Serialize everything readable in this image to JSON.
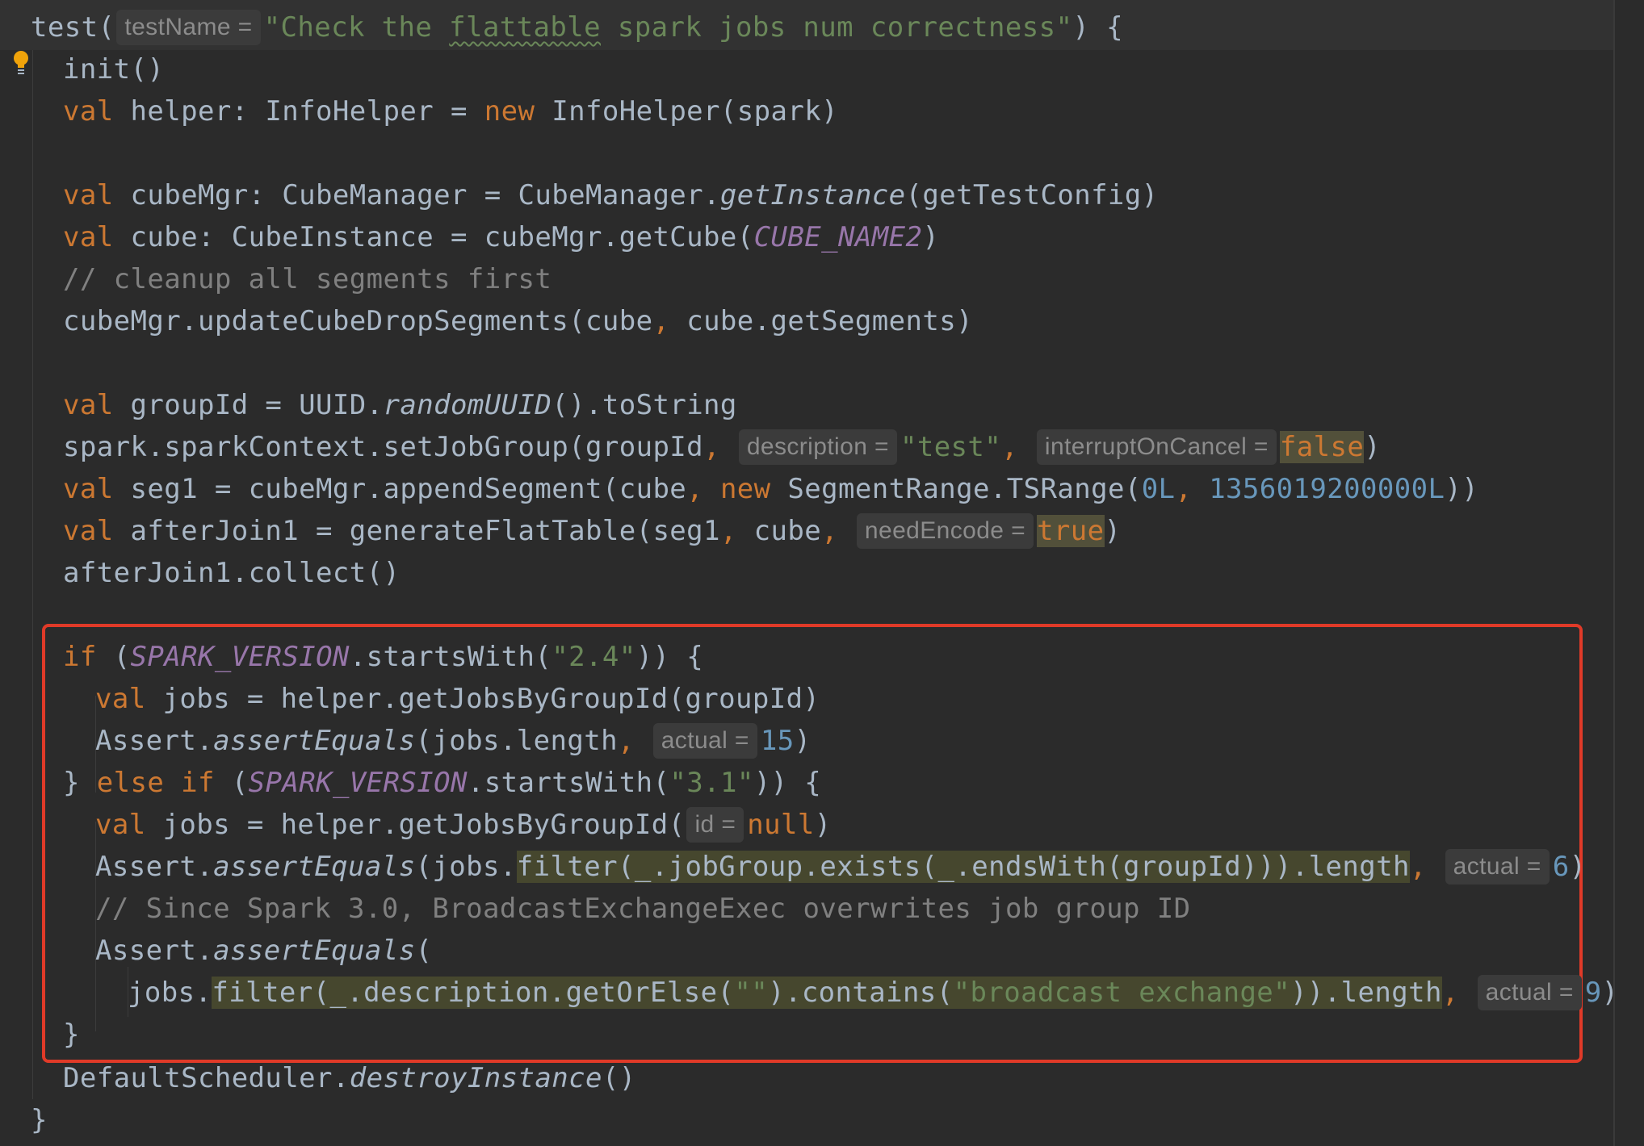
{
  "editor": {
    "theme_colors": {
      "background": "#2b2b2b",
      "keyword": "#cc7832",
      "string": "#6a8759",
      "number": "#6897bb",
      "comment": "#808080",
      "constant": "#9876aa",
      "text": "#a9b7c6",
      "highlight_box": "#e03a28"
    },
    "gutter_icons": [
      "lightbulb-icon"
    ],
    "highlighted_region": {
      "from_line": 16,
      "to_line": 25
    }
  },
  "code": {
    "l1": {
      "a": "test(",
      "hint": "testName =",
      "s1": "\"Check the ",
      "typo": "flattable",
      "s2": " spark jobs num correctness\"",
      "b": ") {"
    },
    "l2": {
      "a": "init()"
    },
    "l3": {
      "kw1": "val",
      "a": " helper: InfoHelper = ",
      "kw2": "new",
      "b": " InfoHelper(spark)"
    },
    "l4": {
      "kw1": "val",
      "a": " cubeMgr: CubeManager = CubeManager.",
      "it": "getInstance",
      "b": "(getTestConfig)"
    },
    "l5": {
      "kw1": "val",
      "a": " cube: CubeInstance = cubeMgr.getCube(",
      "c": "CUBE_NAME2",
      "b": ")"
    },
    "l6": {
      "cmt": "// cleanup all segments first"
    },
    "l7": {
      "a": "cubeMgr.updateCubeDropSegments(cube",
      "p": ",",
      "b": " cube.getSegments)"
    },
    "l8": {
      "kw1": "val",
      "a": " groupId = UUID.",
      "it": "randomUUID",
      "b": "().toString"
    },
    "l9": {
      "a": "spark.sparkContext.setJobGroup(groupId",
      "p1": ",",
      "h1": "description =",
      "s": "\"test\"",
      "p2": ",",
      "h2": "interruptOnCancel =",
      "v": "false",
      "b": ")"
    },
    "l10": {
      "kw1": "val",
      "a": " seg1 = cubeMgr.appendSegment(cube",
      "p1": ",",
      "kw2": "new",
      "b": " SegmentRange.TSRange(",
      "n1": "0L",
      "p2": ",",
      "n2": "1356019200000L",
      "c": "))"
    },
    "l11": {
      "kw1": "val",
      "a": " afterJoin1 = generateFlatTable(seg1",
      "p1": ",",
      "b": " cube",
      "p2": ",",
      "h1": "needEncode =",
      "v": "true",
      "c": ")"
    },
    "l12": {
      "a": "afterJoin1.collect()"
    },
    "l13": {
      "kw1": "if",
      "a": " (",
      "c": "SPARK_VERSION",
      "b": ".startsWith(",
      "s": "\"2.4\"",
      "d": ")) {"
    },
    "l14": {
      "kw1": "val",
      "a": " jobs = helper.getJobsByGroupId(groupId)"
    },
    "l15": {
      "a": "Assert.",
      "it": "assertEquals",
      "b": "(jobs.length",
      "p": ",",
      "h1": "actual =",
      "n": "15",
      "c": ")"
    },
    "l16": {
      "a": "} ",
      "kw1": "else if",
      "b": " (",
      "c": "SPARK_VERSION",
      "d": ".startsWith(",
      "s": "\"3.1\"",
      "e": ")) {"
    },
    "l17": {
      "kw1": "val",
      "a": " jobs = helper.getJobsByGroupId(",
      "h1": "id =",
      "kw2": "null",
      "b": ")"
    },
    "l18": {
      "a": "Assert.",
      "it": "assertEquals",
      "b": "(jobs.",
      "sel": "filter(_.jobGroup.exists(_.endsWith(groupId))).length",
      "p": ",",
      "h1": "actual =",
      "n": "6",
      "c": ")"
    },
    "l19": {
      "cmt": "// Since Spark 3.0, BroadcastExchangeExec overwrites job group ID"
    },
    "l20": {
      "a": "Assert.",
      "it": "assertEquals",
      "b": "("
    },
    "l21": {
      "a": "jobs.",
      "sel1": "filter(_.description.getOrElse(",
      "s1": "\"\"",
      "sel2": ").contains(",
      "s2": "\"broadcast exchange\"",
      "sel3": ")).length",
      "p": ",",
      "h1": "actual =",
      "n": "9",
      "c": ")"
    },
    "l22": {
      "a": "}"
    },
    "l23": {
      "a": "DefaultScheduler.",
      "it": "destroyInstance",
      "b": "()"
    },
    "l24": {
      "a": "}"
    }
  }
}
